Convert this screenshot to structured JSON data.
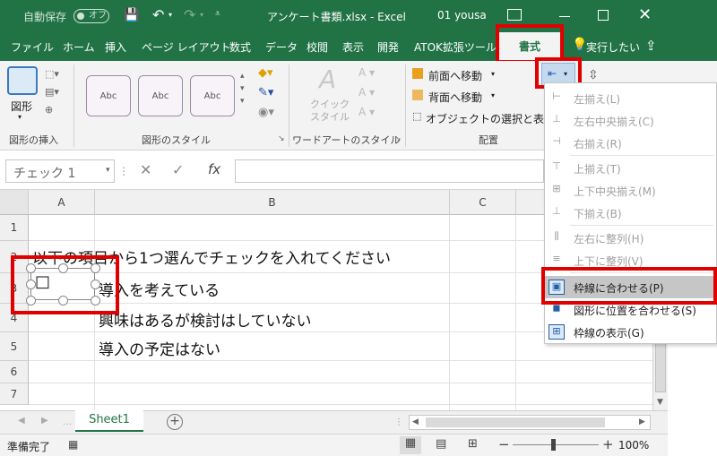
{
  "titlebar": {
    "autosave_label": "自動保存",
    "autosave_state": "オフ",
    "filename": "アンケート書類.xlsx  -  Excel",
    "user": "01 yousa"
  },
  "tabs": [
    "ファイル",
    "ホーム",
    "挿入",
    "ページ レイアウト",
    "数式",
    "データ",
    "校閲",
    "表示",
    "開発",
    "ATOK拡張ツール",
    "書式"
  ],
  "tell_me": "実行したい",
  "ribbon": {
    "shape_label": "図形",
    "group_insert": "図形の挿入",
    "style_samples": [
      "Abc",
      "Abc",
      "Abc"
    ],
    "group_styles": "図形のスタイル",
    "quick_style": "クイック\nスタイル",
    "group_wordart": "ワードアートのスタイル",
    "bring_forward": "前面へ移動",
    "send_backward": "背面へ移動",
    "selection_pane": "オブジェクトの選択と表示",
    "group_arrange": "配置"
  },
  "formula_bar": {
    "name_box": "チェック 1",
    "fx": "fx"
  },
  "columns": [
    "A",
    "B",
    "C"
  ],
  "rows": [
    "1",
    "2",
    "3",
    "4",
    "5",
    "6",
    "7"
  ],
  "cells": {
    "b2": "以下の項目から1つ選んでチェックを入れてください",
    "b3": "導入を考えている",
    "b4": "興味はあるが検討はしていない",
    "b5": "導入の予定はない",
    "checkbox": "□"
  },
  "align_menu": [
    {
      "label": "左揃え(L)",
      "enabled": false
    },
    {
      "label": "左右中央揃え(C)",
      "enabled": false
    },
    {
      "label": "右揃え(R)",
      "enabled": false
    },
    {
      "label": "上揃え(T)",
      "enabled": false
    },
    {
      "label": "上下中央揃え(M)",
      "enabled": false
    },
    {
      "label": "下揃え(B)",
      "enabled": false
    },
    {
      "label": "左右に整列(H)",
      "enabled": false
    },
    {
      "label": "上下に整列(V)",
      "enabled": false
    },
    {
      "label": "枠線に合わせる(P)",
      "enabled": true,
      "highlighted": true
    },
    {
      "label": "図形に位置を合わせる(S)",
      "enabled": true
    },
    {
      "label": "枠線の表示(G)",
      "enabled": true
    }
  ],
  "sheet_tab": "Sheet1",
  "status": {
    "ready": "準備完了",
    "zoom": "100%"
  },
  "colors": {
    "excel_green": "#217346",
    "highlight_red": "#e00000"
  }
}
